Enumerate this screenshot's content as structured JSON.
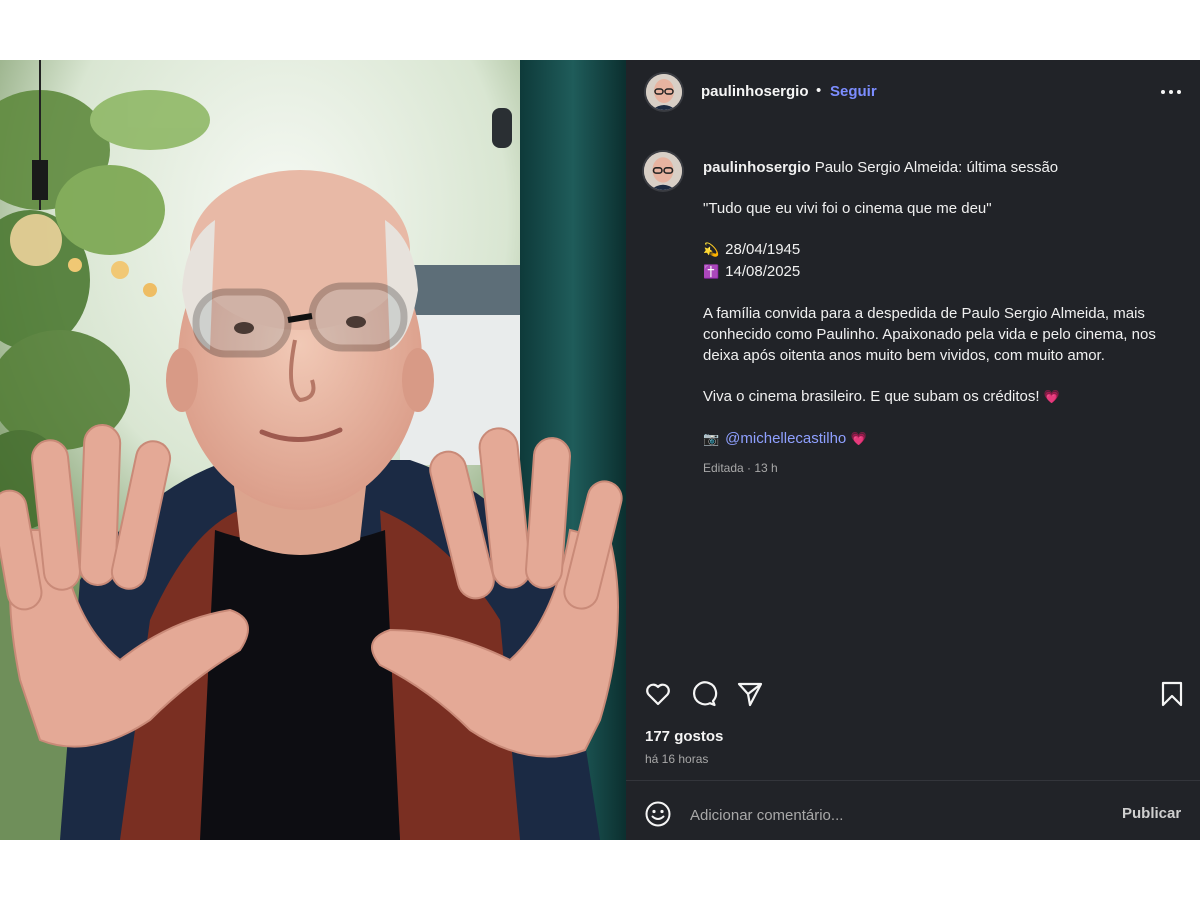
{
  "post": {
    "username": "paulinhosergio",
    "separator": "•",
    "follow_label": "Seguir",
    "caption": {
      "username": "paulinhosergio",
      "title": "Paulo Sergio Almeida: última sessão",
      "quote": "\"Tudo que eu vivi foi o cinema que me deu\"",
      "birth_icon": "💫",
      "birth_date": "28/04/1945",
      "death_icon": "✝️",
      "death_date": "14/08/2025",
      "body": "A família convida para a despedida de Paulo Sergio Almeida, mais conhecido como Paulinho. Apaixonado pela vida e pelo cinema, nos deixa após oitenta anos muito bem vividos, com muito amor.",
      "closing": "Viva o cinema brasileiro. E que subam os créditos!",
      "closing_emoji": "💗",
      "camera_emoji": "📷",
      "mention": "@michellecastilho",
      "mention_emoji": "💗",
      "meta": "Editada · 13 h"
    },
    "likes": "177 gostos",
    "time_ago": "há 16 horas",
    "comment_placeholder": "Adicionar comentário...",
    "publish_label": "Publicar"
  },
  "icons": {
    "more": "more-horizontal-icon",
    "like": "heart-icon",
    "comment": "comment-icon",
    "share": "send-icon",
    "save": "bookmark-icon",
    "emoji": "emoji-smile-icon"
  },
  "colors": {
    "panel_bg": "#212328",
    "link": "#7c8dff",
    "muted": "#a8a8a8",
    "heart_emoji": "#ff4f7b"
  }
}
